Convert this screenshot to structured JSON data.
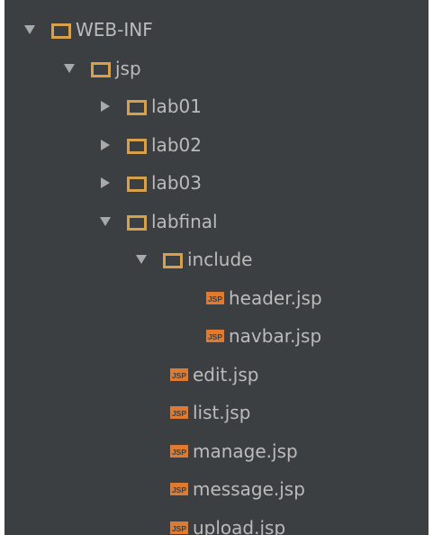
{
  "colors": {
    "background": "#3c3f41",
    "text": "#bbbbbb",
    "folder": "#d6a14a",
    "arrow": "#a9a9a9",
    "jsp_icon": "#e07a2e"
  },
  "tree": {
    "web_inf": {
      "label": "WEB-INF",
      "expanded": true,
      "icon": "folder-icon"
    },
    "jsp": {
      "label": "jsp",
      "expanded": true,
      "icon": "folder-icon"
    },
    "lab01": {
      "label": "lab01",
      "expanded": false,
      "icon": "folder-icon"
    },
    "lab02": {
      "label": "lab02",
      "expanded": false,
      "icon": "folder-icon"
    },
    "lab03": {
      "label": "lab03",
      "expanded": false,
      "icon": "folder-icon"
    },
    "labfinal": {
      "label": "labfinal",
      "expanded": true,
      "icon": "folder-icon"
    },
    "include": {
      "label": "include",
      "expanded": true,
      "icon": "folder-icon"
    },
    "header_jsp": {
      "label": "header.jsp",
      "icon": "jsp-file-icon"
    },
    "navbar_jsp": {
      "label": "navbar.jsp",
      "icon": "jsp-file-icon"
    },
    "edit_jsp": {
      "label": "edit.jsp",
      "icon": "jsp-file-icon"
    },
    "list_jsp": {
      "label": "list.jsp",
      "icon": "jsp-file-icon"
    },
    "manage_jsp": {
      "label": "manage.jsp",
      "icon": "jsp-file-icon"
    },
    "message_jsp": {
      "label": "message.jsp",
      "icon": "jsp-file-icon"
    },
    "upload_jsp": {
      "label": "upload.jsp",
      "icon": "jsp-file-icon"
    }
  }
}
